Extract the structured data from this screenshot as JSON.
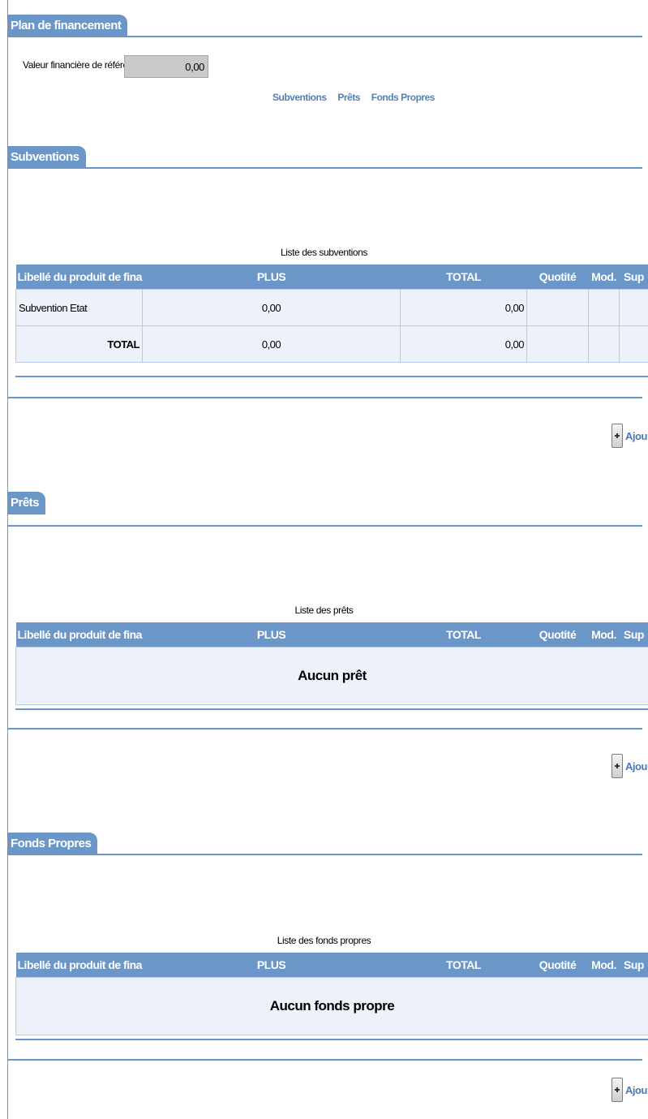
{
  "title": "Plan de financement",
  "reference": {
    "label": "Valeur financière de référence :",
    "value": "0,00"
  },
  "anchors": [
    "Subventions",
    "Prêts",
    "Fonds Propres"
  ],
  "columns": [
    "Libellé du produit de financement",
    "PLUS",
    "TOTAL",
    "Quotité",
    "Mod.",
    "Sup"
  ],
  "subventions": {
    "tab": "Subventions",
    "caption": "Liste des subventions",
    "rows": [
      {
        "label": "Subvention Etat",
        "plus": "0,00",
        "total": "0,00"
      }
    ],
    "total_row": {
      "label": "TOTAL",
      "plus": "0,00",
      "total": "0,00"
    },
    "add_label": "Ajou"
  },
  "prets": {
    "tab": "Prêts",
    "caption": "Liste des prêts",
    "empty": "Aucun prêt",
    "add_label": "Ajou"
  },
  "fonds": {
    "tab": "Fonds Propres",
    "caption": "Liste des fonds propres",
    "empty": "Aucun fonds propre",
    "add_label": "Ajou"
  }
}
